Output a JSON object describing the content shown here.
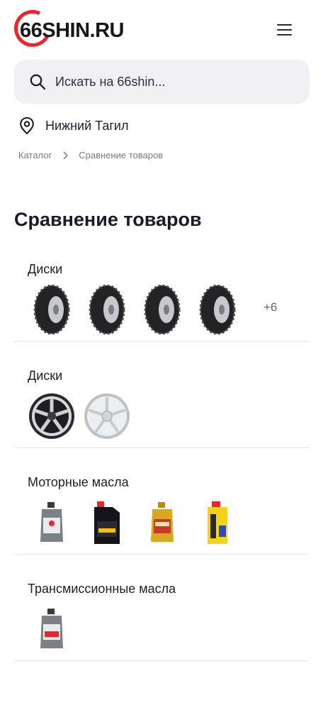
{
  "header": {
    "logo_text": "66SHIN.RU",
    "brand_color": "#e8262c",
    "menu_icon": "hamburger-menu-icon"
  },
  "search": {
    "placeholder": "Искать на 66shin...",
    "icon": "search-icon"
  },
  "location": {
    "city": "Нижний Тагил",
    "icon": "location-pin-icon"
  },
  "breadcrumb": {
    "items": [
      "Каталог",
      "Сравнение товаров"
    ]
  },
  "page": {
    "title": "Сравнение товаров"
  },
  "comparison_groups": [
    {
      "title": "Диски",
      "items": [
        "tire-icon",
        "tire-icon",
        "tire-icon",
        "tire-icon"
      ],
      "more": "+6"
    },
    {
      "title": "Диски",
      "items": [
        "wheel-rim-dark-icon",
        "wheel-rim-silver-icon"
      ]
    },
    {
      "title": "Моторные масла",
      "items": [
        "oil-bottle-icon",
        "oil-canister-icon",
        "oil-bottle-gold-icon",
        "oil-bottle-yellow-icon"
      ]
    },
    {
      "title": "Трансмиссионные масла",
      "items": [
        "oil-bottle-icon"
      ]
    }
  ]
}
